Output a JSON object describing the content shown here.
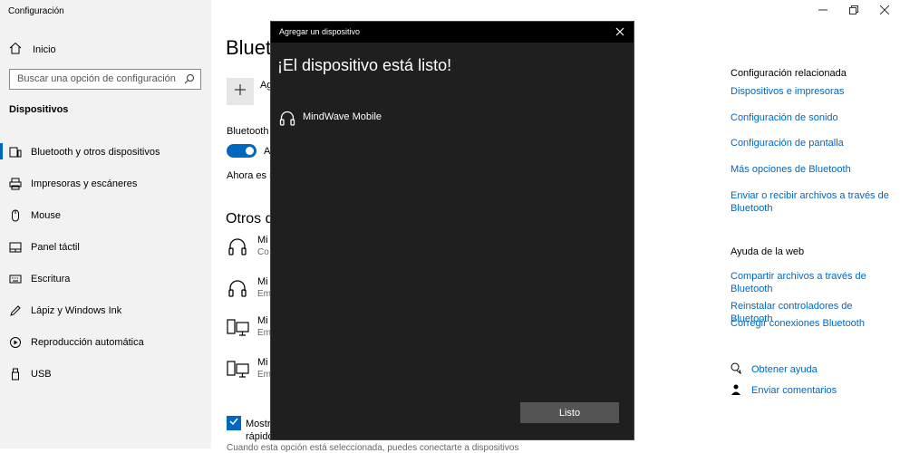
{
  "window": {
    "title": "Configuración"
  },
  "sidebar": {
    "home_label": "Inicio",
    "search_placeholder": "Buscar una opción de configuración",
    "section_title": "Dispositivos",
    "items": [
      {
        "label": "Bluetooth y otros dispositivos",
        "icon": "bluetooth-devices-icon",
        "active": true
      },
      {
        "label": "Impresoras y escáneres",
        "icon": "printer-icon"
      },
      {
        "label": "Mouse",
        "icon": "mouse-icon"
      },
      {
        "label": "Panel táctil",
        "icon": "touchpad-icon"
      },
      {
        "label": "Escritura",
        "icon": "keyboard-icon"
      },
      {
        "label": "Lápiz y Windows Ink",
        "icon": "pen-icon"
      },
      {
        "label": "Reproducción automática",
        "icon": "autoplay-icon"
      },
      {
        "label": "USB",
        "icon": "usb-icon"
      }
    ]
  },
  "main": {
    "title": "Blueto",
    "add_label": "Ag",
    "bluetooth_label": "Bluetooth",
    "toggle_label": "A",
    "now_text": "Ahora es r",
    "other_title": "Otros d",
    "devices": [
      {
        "name": "Mi",
        "status": "Co",
        "icon": "headset-icon"
      },
      {
        "name": "Mi",
        "status": "Em",
        "icon": "headset-icon"
      },
      {
        "name": "Mi",
        "status": "Em",
        "icon": "computer-icon"
      },
      {
        "name": "Mi",
        "status": "Em",
        "icon": "computer-icon"
      }
    ],
    "checkbox_label_1": "Mostr",
    "checkbox_label_2": "rápido",
    "faint_text": "Cuando esta opción está seleccionada, puedes conectarte a dispositivos"
  },
  "related": {
    "title": "Configuración relacionada",
    "links": [
      "Dispositivos e impresoras",
      "Configuración de sonido",
      "Configuración de pantalla",
      "Más opciones de Bluetooth",
      "Enviar o recibir archivos a través de Bluetooth"
    ]
  },
  "web_help": {
    "title": "Ayuda de la web",
    "links": [
      "Compartir archivos a través de Bluetooth",
      "Reinstalar controladores de Bluetooth",
      "Corregir conexiones Bluetooth"
    ]
  },
  "support": {
    "get_help": "Obtener ayuda",
    "feedback": "Enviar comentarios"
  },
  "dialog": {
    "title": "Agregar un dispositivo",
    "heading": "¡El dispositivo está listo!",
    "device_name": "MindWave Mobile",
    "done_label": "Listo"
  },
  "colors": {
    "accent": "#0067c0",
    "dialog_bg": "#1f1f1f",
    "sidebar_bg": "#f2f2f2"
  }
}
